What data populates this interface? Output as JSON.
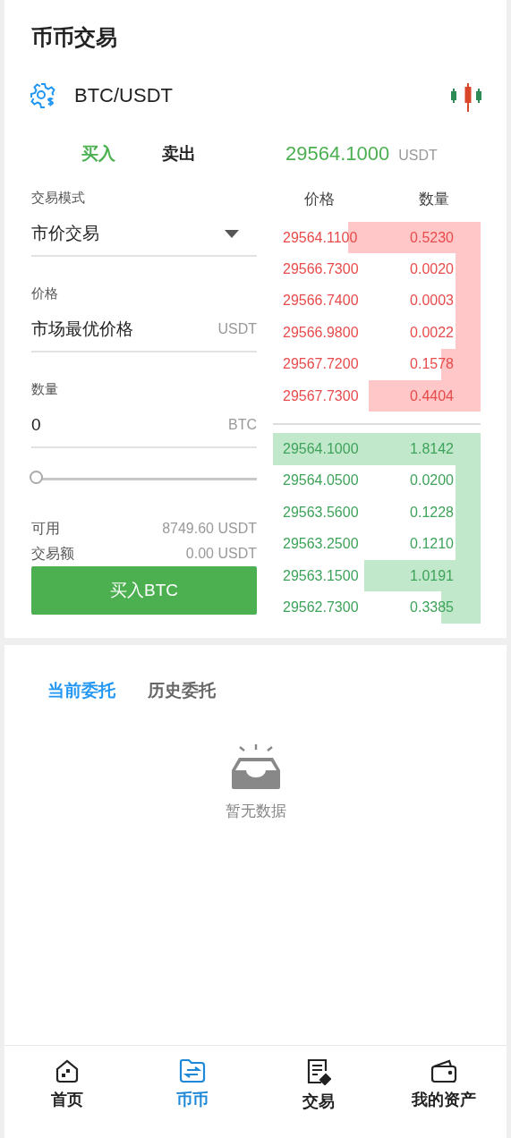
{
  "title": "币币交易",
  "pair": {
    "symbol": "BTC/USDT"
  },
  "side_tabs": [
    {
      "label": "买入",
      "selected": true
    },
    {
      "label": "卖出",
      "selected": false
    }
  ],
  "last_price": {
    "value": "29564.1000",
    "unit": "USDT"
  },
  "form": {
    "mode_label": "交易模式",
    "mode_value": "市价交易",
    "price_label": "价格",
    "price_value": "市场最优价格",
    "price_unit": "USDT",
    "amount_label": "数量",
    "amount_value": "0",
    "amount_unit": "BTC",
    "slider": {
      "level": 0
    },
    "available_label": "可用",
    "available_value": "8749.60 USDT",
    "total_label": "交易额",
    "total_value": "0.00 USDT",
    "submit": "买入BTC"
  },
  "order_book": {
    "columns": [
      "价格",
      "数量"
    ],
    "asks": [
      {
        "price": "29564.1100",
        "amount": "0.5230"
      },
      {
        "price": "29566.7300",
        "amount": "0.0020"
      },
      {
        "price": "29566.7400",
        "amount": "0.0003"
      },
      {
        "price": "29566.9800",
        "amount": "0.0022"
      },
      {
        "price": "29567.7200",
        "amount": "0.1578"
      },
      {
        "price": "29567.7300",
        "amount": "0.4404"
      }
    ],
    "bids": [
      {
        "price": "29564.1000",
        "amount": "1.8142"
      },
      {
        "price": "29564.0500",
        "amount": "0.0200"
      },
      {
        "price": "29563.5600",
        "amount": "0.1228"
      },
      {
        "price": "29563.2500",
        "amount": "0.1210"
      },
      {
        "price": "29563.1500",
        "amount": "1.0191"
      },
      {
        "price": "29562.7300",
        "amount": "0.3385"
      }
    ]
  },
  "order_tabs": [
    {
      "label": "当前委托",
      "selected": true
    },
    {
      "label": "历史委托",
      "selected": false
    }
  ],
  "empty_text": "暂无数据",
  "nav": [
    {
      "label": "首页",
      "kind": "home",
      "selected": false
    },
    {
      "label": "币币",
      "kind": "exchange",
      "selected": true
    },
    {
      "label": "交易",
      "kind": "contract",
      "selected": false
    },
    {
      "label": "我的资产",
      "kind": "wallet",
      "selected": false
    }
  ]
}
